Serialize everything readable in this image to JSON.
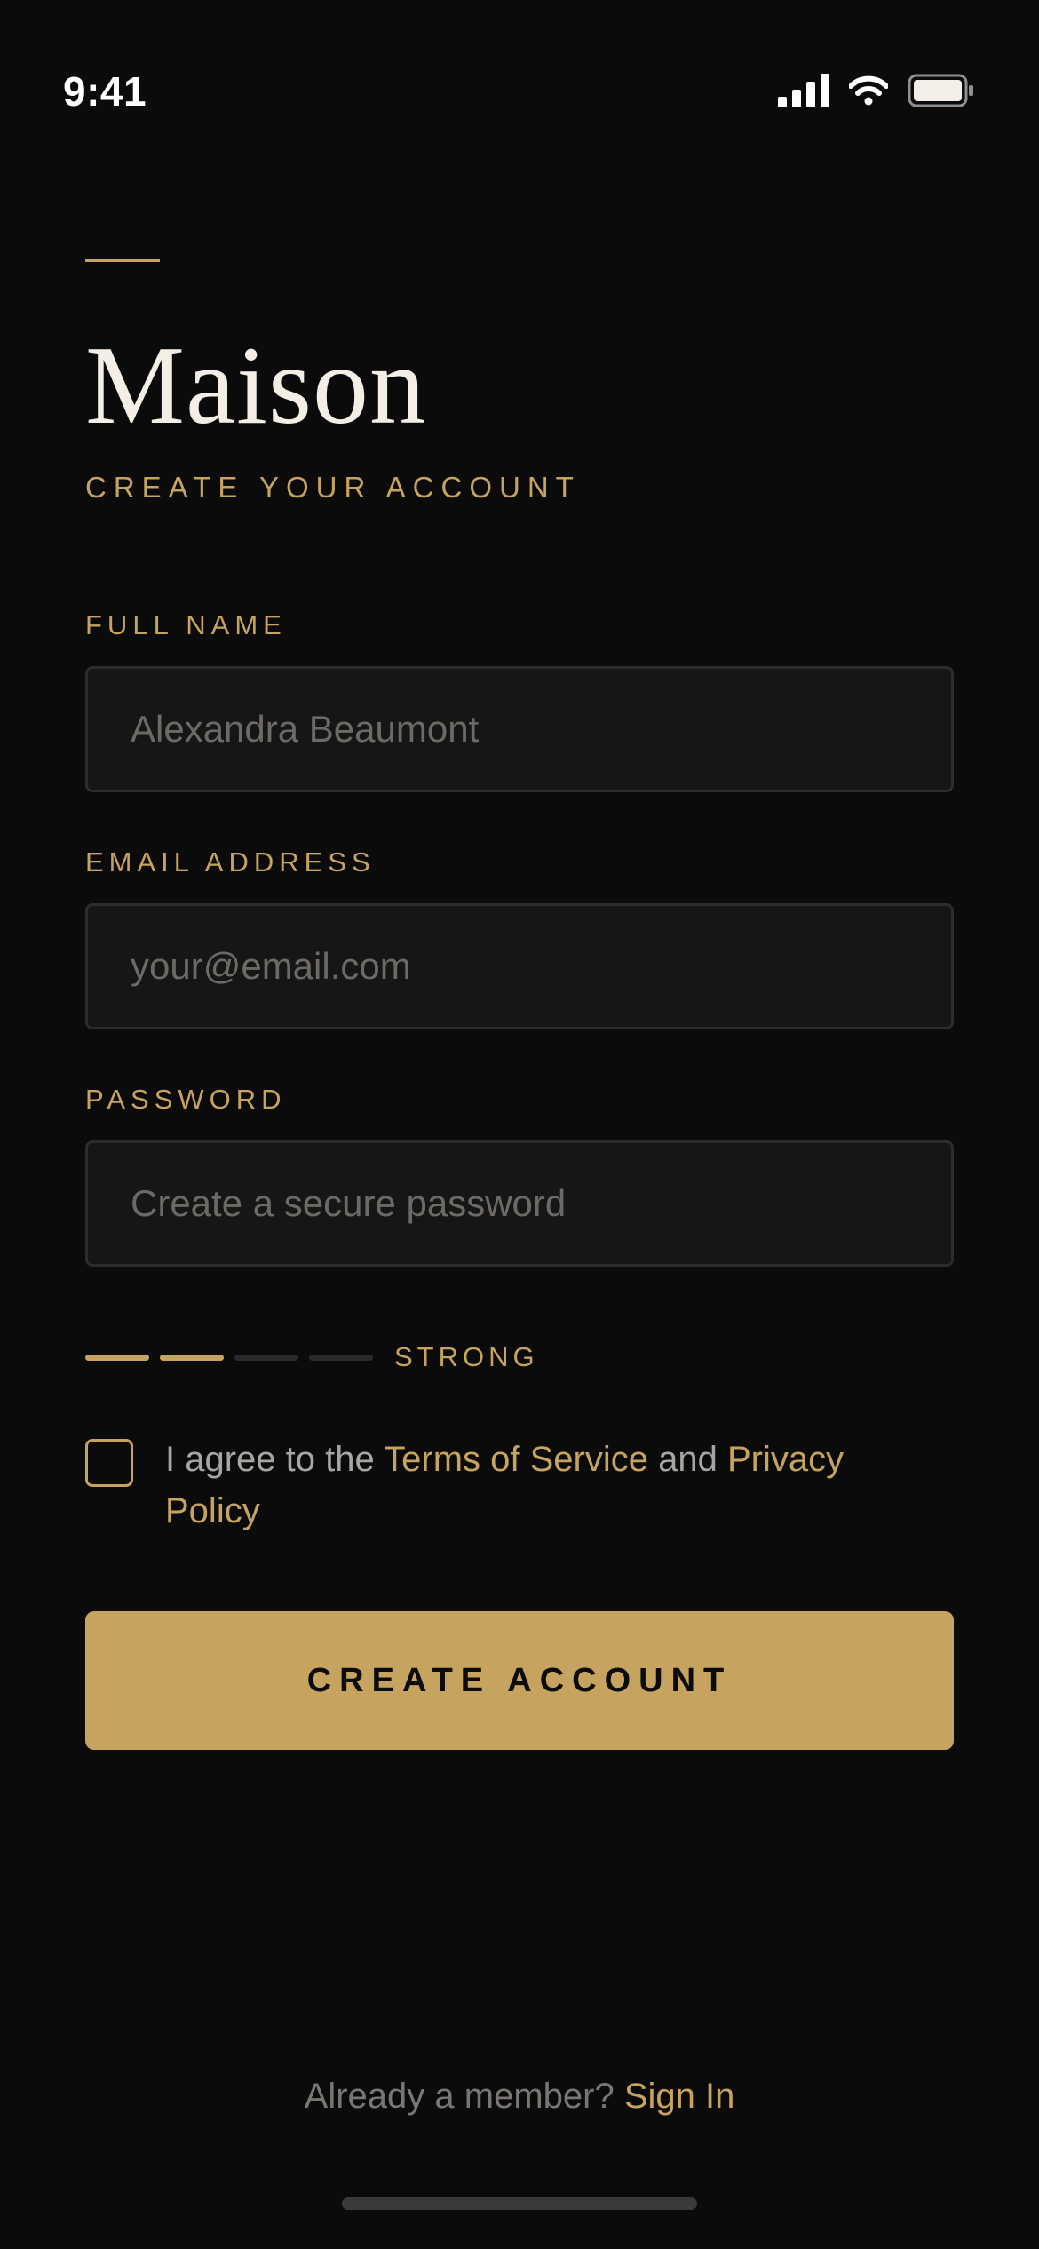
{
  "status_bar": {
    "time": "9:41",
    "icons": [
      "signal-icon",
      "wifi-icon",
      "battery-icon"
    ]
  },
  "brand": {
    "title": "Maison",
    "subtitle": "CREATE YOUR ACCOUNT"
  },
  "form": {
    "full_name": {
      "label": "FULL NAME",
      "value": "",
      "placeholder": "Alexandra Beaumont"
    },
    "email": {
      "label": "EMAIL ADDRESS",
      "value": "",
      "placeholder": "your@email.com"
    },
    "password": {
      "label": "PASSWORD",
      "value": "",
      "placeholder": "Create a secure password"
    },
    "strength": {
      "label": "STRONG",
      "level": 2,
      "max": 4
    },
    "agree": {
      "checked": false,
      "prefix": "I agree to the ",
      "terms_link": "Terms of Service",
      "middle": " and ",
      "privacy_link": "Privacy Policy"
    },
    "submit_label": "CREATE ACCOUNT"
  },
  "footer": {
    "prompt": "Already a member? ",
    "sign_in_link": "Sign In"
  },
  "colors": {
    "background": "#0b0b0b",
    "accent": "#c6a35e",
    "text_primary": "#f3efe6",
    "input_background": "#161616",
    "input_border": "#2c2c2c",
    "muted_text": "#7a7773"
  }
}
